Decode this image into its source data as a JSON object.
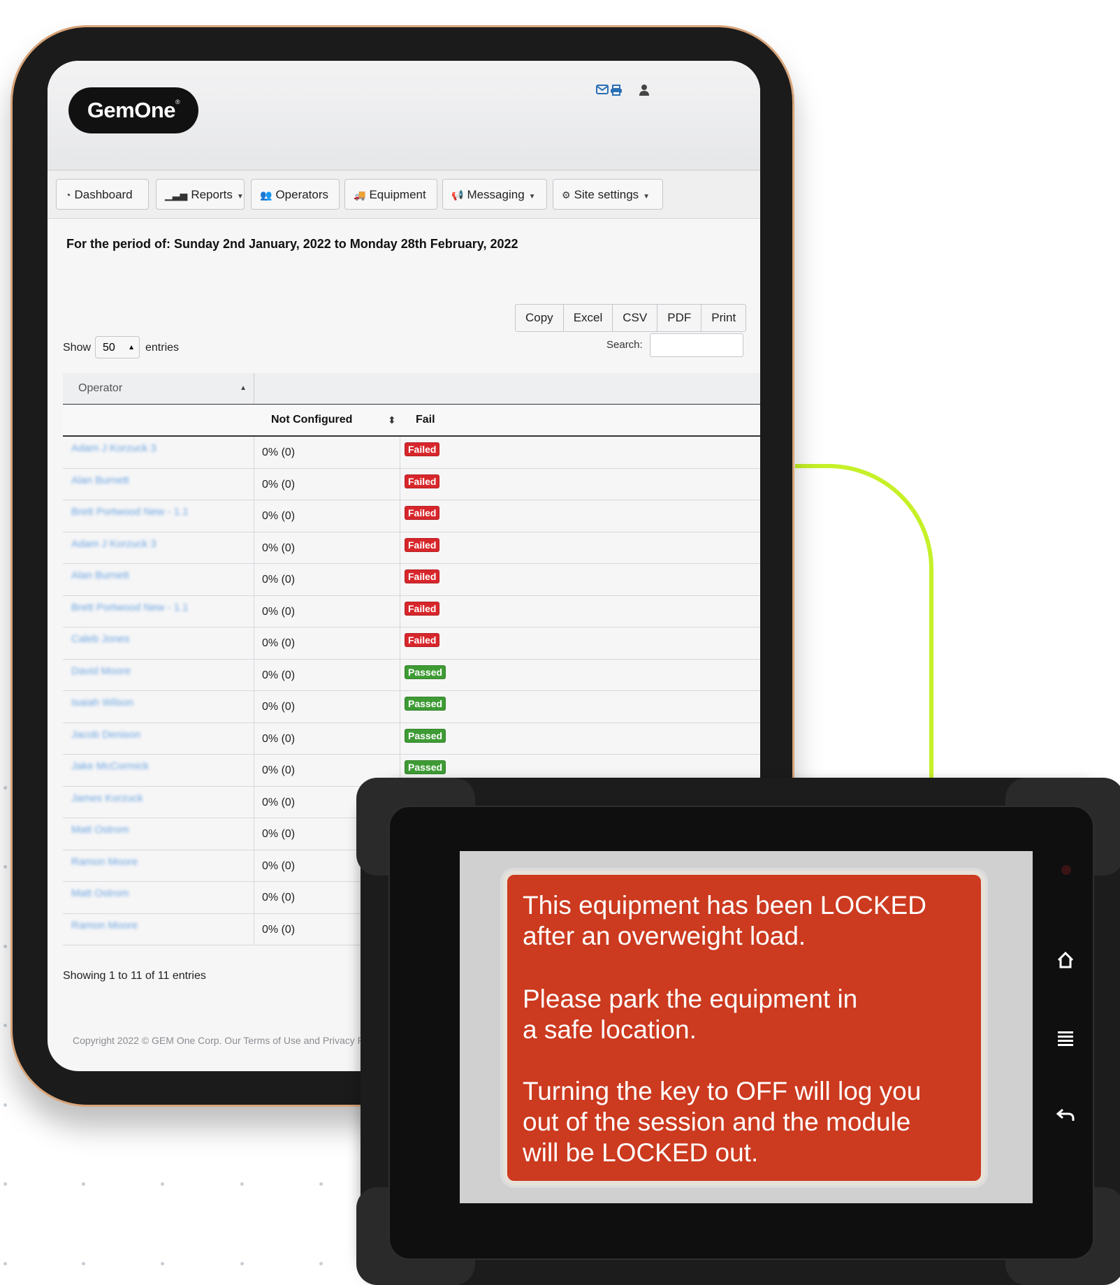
{
  "app": {
    "logo": "GemOne",
    "logo_mark": "®",
    "top_icons": [
      "envelope-icon",
      "print-icon",
      "user-icon"
    ]
  },
  "nav": {
    "items": [
      {
        "label": "Dashboard",
        "icon": "dashboard-icon",
        "dropdown": false
      },
      {
        "label": "Reports",
        "icon": "bar-chart-icon",
        "dropdown": true
      },
      {
        "label": "Operators",
        "icon": "users-icon",
        "dropdown": false
      },
      {
        "label": "Equipment",
        "icon": "truck-icon",
        "dropdown": false
      },
      {
        "label": "Messaging",
        "icon": "megaphone-icon",
        "dropdown": true
      },
      {
        "label": "Site settings",
        "icon": "gear-icon",
        "dropdown": true
      }
    ]
  },
  "report": {
    "period": "For the period of: Sunday 2nd January, 2022 to Monday 28th February, 2022",
    "export_buttons": [
      "Copy",
      "Excel",
      "CSV",
      "PDF",
      "Print"
    ],
    "search_label": "Search:",
    "search_value": "",
    "show_label": "Show",
    "show_value": "50",
    "entries_label": "entries"
  },
  "table": {
    "header_operator": "Operator",
    "header_not_configured": "Not Configured",
    "header_fail": "Fail",
    "rows": [
      {
        "operator": "Adam J Korzuck 3",
        "not_configured": "0% (0)",
        "status": "Failed"
      },
      {
        "operator": "Alan Burnett",
        "not_configured": "0% (0)",
        "status": "Failed"
      },
      {
        "operator": "Brett Portwood New - 1.1",
        "not_configured": "0% (0)",
        "status": "Failed"
      },
      {
        "operator": "Adam J Korzuck 3",
        "not_configured": "0% (0)",
        "status": "Failed"
      },
      {
        "operator": "Alan Burnett",
        "not_configured": "0% (0)",
        "status": "Failed"
      },
      {
        "operator": "Brett Portwood New - 1.1",
        "not_configured": "0% (0)",
        "status": "Failed"
      },
      {
        "operator": "Caleb Jones",
        "not_configured": "0% (0)",
        "status": "Failed"
      },
      {
        "operator": "David Moore",
        "not_configured": "0% (0)",
        "status": "Passed"
      },
      {
        "operator": "Isaiah Wilson",
        "not_configured": "0% (0)",
        "status": "Passed"
      },
      {
        "operator": "Jacob Denison",
        "not_configured": "0% (0)",
        "status": "Passed"
      },
      {
        "operator": "Jake McCormick",
        "not_configured": "0% (0)",
        "status": "Passed"
      },
      {
        "operator": "James Korzuck",
        "not_configured": "0% (0)",
        "status": ""
      },
      {
        "operator": "Matt Ostrom",
        "not_configured": "0% (0)",
        "status": ""
      },
      {
        "operator": "Ramon Moore",
        "not_configured": "0% (0)",
        "status": ""
      },
      {
        "operator": "Matt Ostrom",
        "not_configured": "0% (0)",
        "status": ""
      },
      {
        "operator": "Ramon Moore",
        "not_configured": "0% (0)",
        "status": ""
      }
    ],
    "showing": "Showing 1 to 11 of 11 entries"
  },
  "footer": {
    "copyright": "Copyright 2022 © GEM One Corp. Our Terms of Use and Privacy Po"
  },
  "device": {
    "message_lines": [
      "This equipment has been LOCKED\nafter an overweight load.",
      "Please park the equipment in\na safe location.",
      "Turning the key to OFF will log you\nout of the session and the module\nwill be LOCKED out."
    ],
    "side_buttons": [
      "home-icon",
      "menu-icon",
      "back-icon"
    ]
  },
  "colors": {
    "accent_connector": "#c6f028",
    "failed_badge": "#d7262b",
    "passed_badge": "#3e9b34",
    "message_background": "#cc3a1f",
    "link": "#4a90d9"
  }
}
